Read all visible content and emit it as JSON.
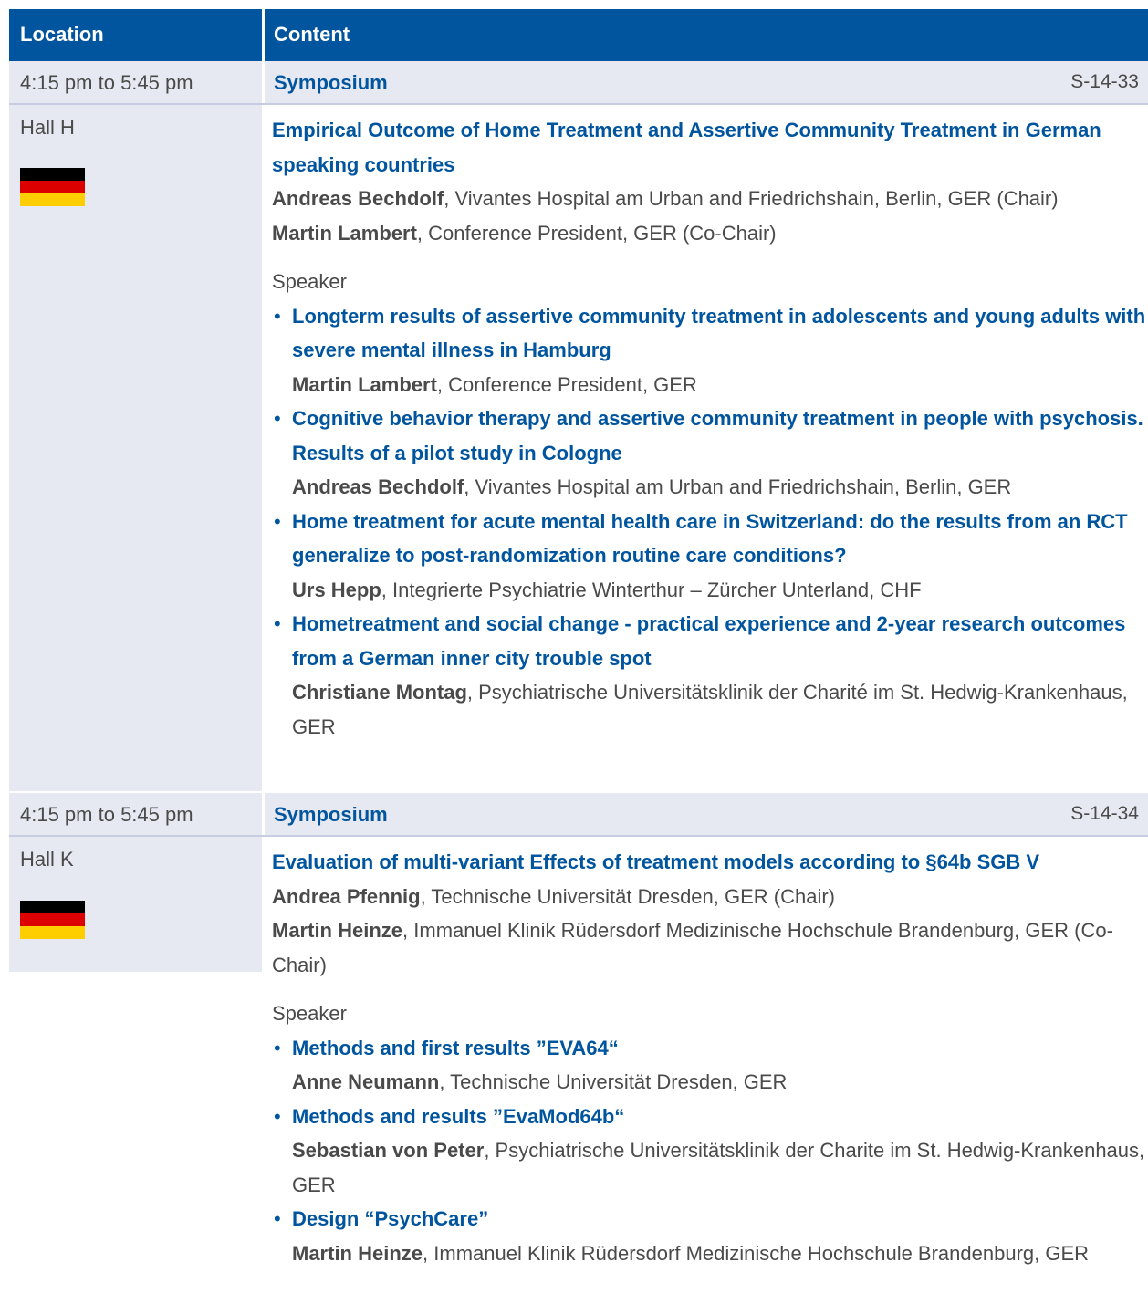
{
  "header": {
    "location": "Location",
    "content": "Content"
  },
  "sessions": [
    {
      "time": "4:15 pm to 5:45 pm",
      "kind": "Symposium",
      "code": "S-14-33",
      "hall": "Hall H",
      "title": "Empirical Outcome of Home Treatment and Assertive Community Treatment in German speaking countries",
      "chairs": [
        {
          "name": "Andreas Bechdolf",
          "affiliation": ", Vivantes Hospital am Urban and Friedrichshain, Berlin, GER (Chair)"
        },
        {
          "name": "Martin Lambert",
          "affiliation": ", Conference President, GER (Co-Chair)"
        }
      ],
      "speaker_label": "Speaker",
      "talks": [
        {
          "title": "Longterm results of assertive community treatment in adolescents and young adults with severe mental illness in Hamburg",
          "name": "Martin Lambert",
          "affiliation": ", Conference President, GER"
        },
        {
          "title": "Cognitive behavior therapy and assertive community treatment in people with psychosis. Results of a pilot study in Cologne",
          "name": "Andreas Bechdolf",
          "affiliation": ", Vivantes Hospital am Urban and Friedrichshain, Berlin, GER"
        },
        {
          "title": "Home treatment for acute mental health care in Switzerland: do the results from an RCT generalize to post-randomization routine care conditions?",
          "name": "Urs Hepp",
          "affiliation": ", Integrierte Psychiatrie Winterthur – Zürcher Unterland, CHF"
        },
        {
          "title": "Hometreatment and social change - practical experience and 2-year research outcomes from a German inner city trouble spot",
          "name": "Christiane Montag",
          "affiliation": ", Psychiatrische Universitätsklinik der Charité im St. Hedwig-Krankenhaus, GER"
        }
      ]
    },
    {
      "time": "4:15 pm to 5:45 pm",
      "kind": "Symposium",
      "code": "S-14-34",
      "hall": "Hall K",
      "title": "Evaluation of multi-variant Effects of treatment models according to §64b SGB V",
      "chairs": [
        {
          "name": "Andrea Pfennig",
          "affiliation": ", Technische Universität Dresden, GER (Chair)"
        },
        {
          "name": "Martin Heinze",
          "affiliation": ", Immanuel Klinik Rüdersdorf Medizinische Hochschule Brandenburg, GER (Co-Chair)"
        }
      ],
      "speaker_label": "Speaker",
      "talks": [
        {
          "title": "Methods and first results ”EVA64“",
          "name": "Anne Neumann",
          "affiliation": ", Technische Universität Dresden, GER"
        },
        {
          "title": "Methods and results ”EvaMod64b“",
          "name": "Sebastian von Peter",
          "affiliation": ", Psychiatrische Universitätsklinik der Charite im St. Hedwig-Krankenhaus, GER"
        },
        {
          "title": "Design “PsychCare”",
          "name": "Martin Heinze",
          "affiliation": ", Immanuel Klinik Rüdersdorf Medizinische Hochschule Brandenburg, GER"
        }
      ]
    }
  ],
  "flag": {
    "colors": [
      "#000000",
      "#dd0000",
      "#ffce00"
    ],
    "icon": "german-flag-icon"
  }
}
